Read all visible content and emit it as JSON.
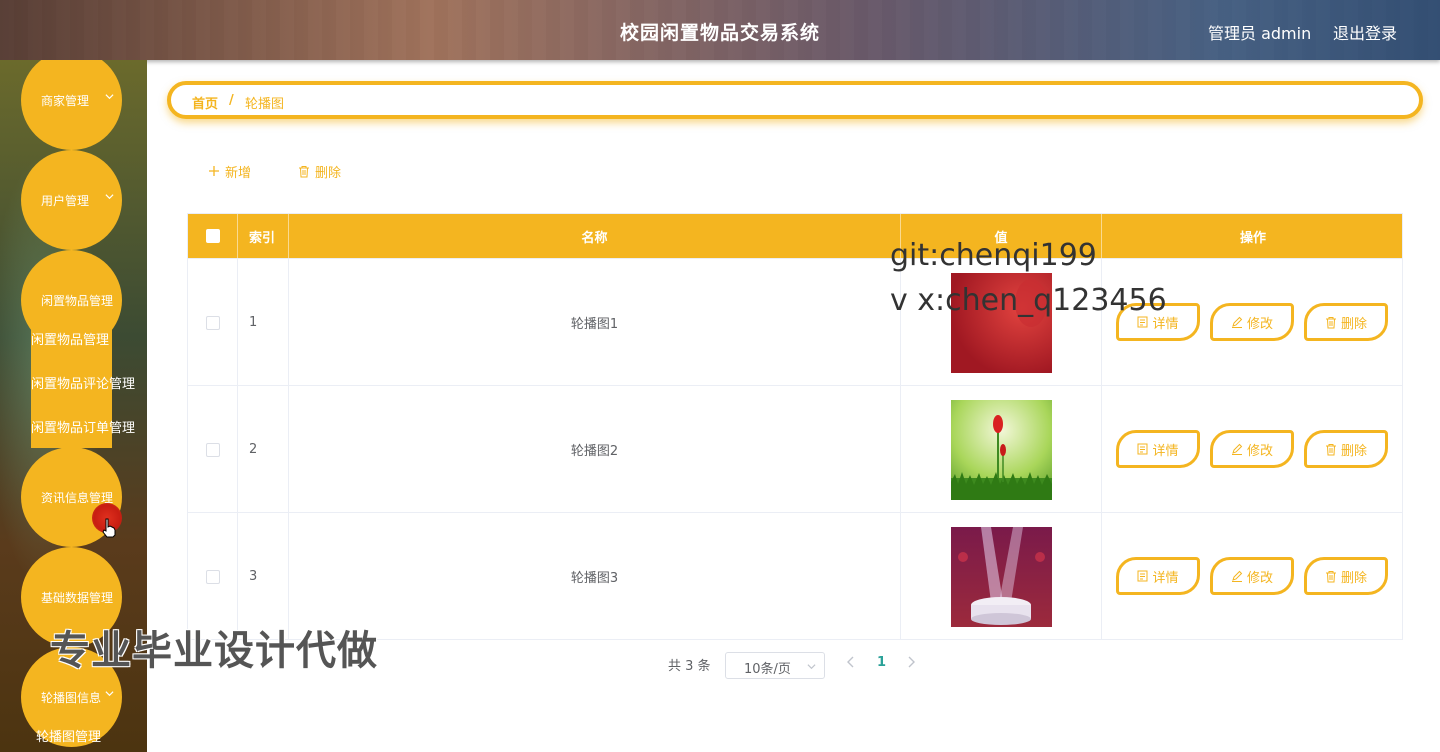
{
  "header": {
    "title": "校园闲置物品交易系统",
    "user": "管理员 admin",
    "logout": "退出登录"
  },
  "sidebar": {
    "menus": [
      {
        "label": "商家管理",
        "has_chevron": true
      },
      {
        "label": "用户管理",
        "has_chevron": true
      },
      {
        "label": "闲置物品管理",
        "has_chevron": false
      },
      {
        "label": "资讯信息管理",
        "has_chevron": false
      },
      {
        "label": "基础数据管理",
        "has_chevron": false
      },
      {
        "label": "轮播图信息",
        "has_chevron": true
      }
    ],
    "submenu_goods": [
      "闲置物品管理",
      "闲置物品评论管理",
      "闲置物品订单管理"
    ],
    "submenu_carousel": [
      "轮播图管理"
    ]
  },
  "breadcrumb": {
    "home": "首页",
    "separator": "/",
    "current": "轮播图"
  },
  "toolbar": {
    "add": "新增",
    "delete": "删除"
  },
  "table": {
    "headers": {
      "index": "索引",
      "name": "名称",
      "value": "值",
      "actions": "操作"
    },
    "rows": [
      {
        "index": "1",
        "name": "轮播图1",
        "image": "red-gradient"
      },
      {
        "index": "2",
        "name": "轮播图2",
        "image": "tulip-green"
      },
      {
        "index": "3",
        "name": "轮播图3",
        "image": "stage-purple"
      }
    ],
    "actions": {
      "detail": "详情",
      "edit": "修改",
      "delete": "删除"
    }
  },
  "pagination": {
    "total": "共 3 条",
    "page_size": "10条/页",
    "current_page": "1"
  },
  "watermarks": {
    "git": "git:chenqi199",
    "vx": "v x:chen_q123456",
    "ad": "专业毕业设计代做"
  },
  "colors": {
    "accent": "#f4b520",
    "page_active": "#2aa198"
  }
}
